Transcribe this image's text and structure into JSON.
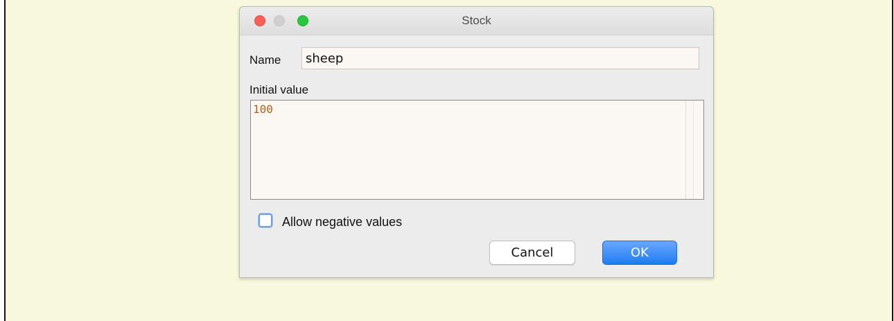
{
  "dialog": {
    "title": "Stock",
    "name_label": "Name",
    "name_value": "sheep",
    "initial_value_label": "Initial value",
    "initial_value_text": "100",
    "allow_negative_label": "Allow negative values",
    "allow_negative_checked": false,
    "cancel_label": "Cancel",
    "ok_label": "OK"
  },
  "colors": {
    "background": "#f8f8dc",
    "dialog": "#ececec",
    "ok_button": "#1f7cf2",
    "value_text": "#b45f20",
    "close_button": "#ff5f57",
    "minimize_button": "#d0d0d0",
    "maximize_button": "#28c840"
  }
}
